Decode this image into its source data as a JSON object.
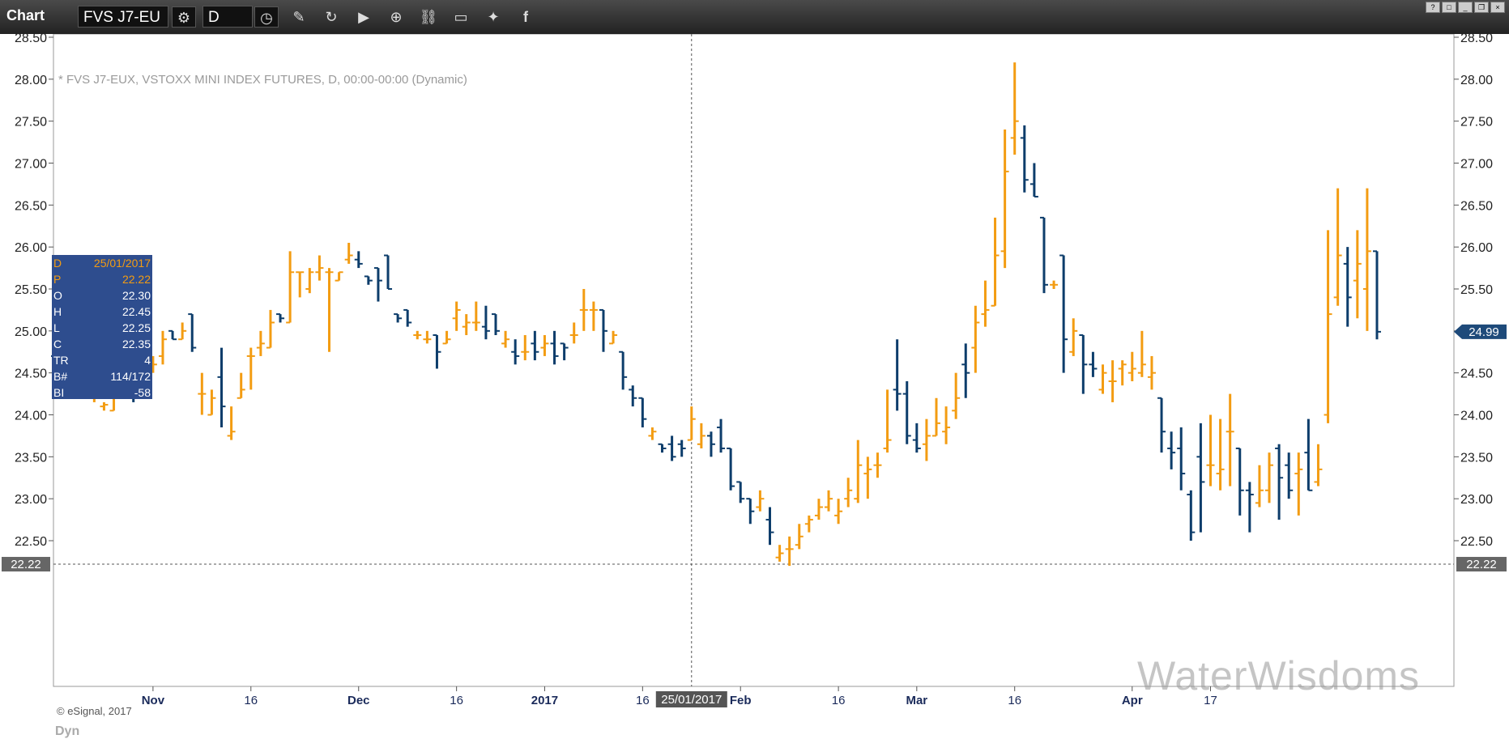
{
  "toolbar": {
    "title": "Chart",
    "symbol": "FVS J7-EU",
    "interval": "D"
  },
  "chart_title": "* FVS J7-EUX, VSTOXX MINI INDEX FUTURES, D, 00:00-00:00 (Dynamic)",
  "copyright": "© eSignal, 2017",
  "watermark": "WaterWisdoms",
  "dyn_label": "Dyn",
  "data_window": {
    "rows": [
      {
        "k": "D",
        "v": "25/01/2017",
        "hl": true
      },
      {
        "k": "P",
        "v": "22.22",
        "hl": true
      },
      {
        "k": "O",
        "v": "22.30",
        "hl": false
      },
      {
        "k": "H",
        "v": "22.45",
        "hl": false
      },
      {
        "k": "L",
        "v": "22.25",
        "hl": false
      },
      {
        "k": "C",
        "v": "22.35",
        "hl": false
      },
      {
        "k": "TR",
        "v": "4",
        "hl": false
      },
      {
        "k": "B#",
        "v": "114/172",
        "hl": false
      },
      {
        "k": "BI",
        "v": "-58",
        "hl": false
      }
    ]
  },
  "colors": {
    "up": "#f39c12",
    "down": "#0d3d6b",
    "badge": "#1e4a7a"
  },
  "chart_data": {
    "type": "ohlc",
    "ylim": [
      22.0,
      28.6
    ],
    "y_ticks": [
      "28.50",
      "28.00",
      "27.50",
      "27.00",
      "26.50",
      "26.00",
      "25.50",
      "25.00",
      "24.50",
      "24.00",
      "23.50",
      "23.00",
      "22.50"
    ],
    "x_tick_labels": [
      {
        "label": "Nov",
        "idx": 10,
        "bold": true
      },
      {
        "label": "16",
        "idx": 20,
        "bold": false
      },
      {
        "label": "Dec",
        "idx": 31,
        "bold": true
      },
      {
        "label": "16",
        "idx": 41,
        "bold": false
      },
      {
        "label": "2017",
        "idx": 50,
        "bold": true
      },
      {
        "label": "16",
        "idx": 60,
        "bold": false
      },
      {
        "label": "Feb",
        "idx": 70,
        "bold": true
      },
      {
        "label": "16",
        "idx": 80,
        "bold": false
      },
      {
        "label": "Mar",
        "idx": 88,
        "bold": true
      },
      {
        "label": "16",
        "idx": 98,
        "bold": false
      },
      {
        "label": "Apr",
        "idx": 110,
        "bold": true
      },
      {
        "label": "17",
        "idx": 118,
        "bold": false
      }
    ],
    "crosshair": {
      "idx": 65,
      "date_label": "25/01/2017",
      "price": 22.22,
      "price_label": "22.22"
    },
    "last_price": {
      "value": 24.99,
      "label": "24.99"
    },
    "bars": [
      [
        24.7,
        24.75,
        24.6,
        24.6
      ],
      [
        24.45,
        24.5,
        24.45,
        24.48
      ],
      [
        24.45,
        24.45,
        24.35,
        24.4
      ],
      [
        24.3,
        24.35,
        24.25,
        24.32
      ],
      [
        24.2,
        24.3,
        24.15,
        24.25
      ],
      [
        24.1,
        24.15,
        24.05,
        24.12
      ],
      [
        24.05,
        24.35,
        24.05,
        24.3
      ],
      [
        24.3,
        24.5,
        24.25,
        24.3
      ],
      [
        24.3,
        24.3,
        24.15,
        24.25
      ],
      [
        24.5,
        24.6,
        24.5,
        24.55
      ],
      [
        24.55,
        24.7,
        24.5,
        24.6
      ],
      [
        24.7,
        25.0,
        24.6,
        24.9
      ],
      [
        25.0,
        25.0,
        24.9,
        24.9
      ],
      [
        24.9,
        25.1,
        24.9,
        25.0
      ],
      [
        25.2,
        25.2,
        24.75,
        24.8
      ],
      [
        24.25,
        24.5,
        24.0,
        24.25
      ],
      [
        24.0,
        24.3,
        24.0,
        24.2
      ],
      [
        24.45,
        24.8,
        23.85,
        24.1
      ],
      [
        23.75,
        24.1,
        23.7,
        23.8
      ],
      [
        24.2,
        24.5,
        24.2,
        24.3
      ],
      [
        24.7,
        24.8,
        24.3,
        24.7
      ],
      [
        24.8,
        25.0,
        24.7,
        24.85
      ],
      [
        24.8,
        25.25,
        24.8,
        25.1
      ],
      [
        25.2,
        25.2,
        25.1,
        25.15
      ],
      [
        25.1,
        25.95,
        25.1,
        25.7
      ],
      [
        25.7,
        25.7,
        25.4,
        25.7
      ],
      [
        25.5,
        25.75,
        25.45,
        25.7
      ],
      [
        25.7,
        25.9,
        25.6,
        25.75
      ],
      [
        25.7,
        25.75,
        24.75,
        25.7
      ],
      [
        25.6,
        25.7,
        25.6,
        25.7
      ],
      [
        25.85,
        26.05,
        25.8,
        25.9
      ],
      [
        25.85,
        25.95,
        25.75,
        25.8
      ],
      [
        25.65,
        25.65,
        25.55,
        25.6
      ],
      [
        25.75,
        25.75,
        25.35,
        25.6
      ],
      [
        25.9,
        25.9,
        25.5,
        25.5
      ],
      [
        25.2,
        25.2,
        25.1,
        25.15
      ],
      [
        25.25,
        25.25,
        25.05,
        25.1
      ],
      [
        24.95,
        25.0,
        24.9,
        24.95
      ],
      [
        24.9,
        25.0,
        24.85,
        24.9
      ],
      [
        24.95,
        24.95,
        24.55,
        24.75
      ],
      [
        24.85,
        25.0,
        24.85,
        24.9
      ],
      [
        25.15,
        25.35,
        25.0,
        25.25
      ],
      [
        25.05,
        25.2,
        24.95,
        25.1
      ],
      [
        25.1,
        25.35,
        25.0,
        25.1
      ],
      [
        25.05,
        25.3,
        24.9,
        25.0
      ],
      [
        25.2,
        25.2,
        24.95,
        25.0
      ],
      [
        24.85,
        25.0,
        24.8,
        24.9
      ],
      [
        24.75,
        24.9,
        24.6,
        24.7
      ],
      [
        24.75,
        24.95,
        24.65,
        24.75
      ],
      [
        24.85,
        25.0,
        24.65,
        24.75
      ],
      [
        24.8,
        24.95,
        24.7,
        24.85
      ],
      [
        24.85,
        25.0,
        24.6,
        24.7
      ],
      [
        24.85,
        24.85,
        24.65,
        24.8
      ],
      [
        24.95,
        25.1,
        24.85,
        24.95
      ],
      [
        25.25,
        25.5,
        25.0,
        25.25
      ],
      [
        25.25,
        25.35,
        25.0,
        25.25
      ],
      [
        25.25,
        25.25,
        24.75,
        25.0
      ],
      [
        24.85,
        25.0,
        24.85,
        24.95
      ],
      [
        24.75,
        24.75,
        24.3,
        24.45
      ],
      [
        24.3,
        24.35,
        24.1,
        24.2
      ],
      [
        24.2,
        24.2,
        23.85,
        23.95
      ],
      [
        23.75,
        23.85,
        23.7,
        23.8
      ],
      [
        23.65,
        23.65,
        23.55,
        23.6
      ],
      [
        23.65,
        23.75,
        23.45,
        23.5
      ]
    ],
    "bars_b": [
      [
        23.65,
        23.7,
        23.5,
        23.6
      ],
      [
        23.7,
        24.1,
        23.7,
        23.95
      ],
      [
        23.65,
        23.9,
        23.6,
        23.75
      ],
      [
        23.75,
        23.8,
        23.5,
        23.65
      ],
      [
        23.85,
        23.95,
        23.55,
        23.6
      ],
      [
        23.6,
        23.6,
        23.1,
        23.15
      ],
      [
        23.2,
        23.2,
        22.95,
        23.0
      ],
      [
        23.0,
        23.0,
        22.7,
        22.85
      ],
      [
        22.9,
        23.1,
        22.85,
        23.0
      ],
      [
        22.75,
        22.9,
        22.45,
        22.6
      ],
      [
        22.3,
        22.45,
        22.25,
        22.35
      ],
      [
        22.4,
        22.55,
        22.2,
        22.4
      ],
      [
        22.45,
        22.7,
        22.4,
        22.55
      ],
      [
        22.7,
        22.8,
        22.6,
        22.75
      ],
      [
        22.8,
        23.0,
        22.75,
        22.9
      ],
      [
        22.9,
        23.1,
        22.85,
        23.0
      ],
      [
        22.8,
        23.0,
        22.7,
        22.85
      ],
      [
        23.0,
        23.25,
        22.9,
        23.1
      ],
      [
        23.0,
        23.7,
        22.95,
        23.4
      ],
      [
        23.3,
        23.5,
        23.0,
        23.35
      ],
      [
        23.4,
        23.55,
        23.25,
        23.4
      ],
      [
        23.6,
        24.3,
        23.55,
        23.7
      ],
      [
        24.3,
        24.9,
        24.05,
        24.25
      ],
      [
        24.25,
        24.4,
        23.65,
        23.75
      ],
      [
        23.7,
        23.9,
        23.55,
        23.6
      ],
      [
        23.65,
        23.95,
        23.45,
        23.75
      ],
      [
        23.75,
        24.2,
        23.75,
        23.9
      ],
      [
        23.8,
        24.1,
        23.65,
        23.85
      ],
      [
        24.05,
        24.5,
        23.95,
        24.2
      ],
      [
        24.6,
        24.85,
        24.2,
        24.5
      ],
      [
        24.8,
        25.3,
        24.5,
        25.1
      ],
      [
        25.2,
        25.6,
        25.05,
        25.25
      ],
      [
        25.3,
        26.35,
        25.3,
        25.9
      ],
      [
        25.95,
        27.4,
        25.75,
        26.9
      ],
      [
        27.3,
        28.2,
        27.1,
        27.5
      ],
      [
        27.3,
        27.45,
        26.65,
        26.8
      ],
      [
        26.75,
        27.0,
        26.6,
        26.6
      ],
      [
        26.35,
        26.35,
        25.45,
        25.55
      ],
      [
        25.55,
        25.6,
        25.5,
        25.55
      ],
      [
        25.9,
        25.9,
        24.5,
        24.9
      ],
      [
        24.75,
        25.15,
        24.7,
        25.0
      ],
      [
        24.95,
        24.95,
        24.25,
        24.6
      ],
      [
        24.6,
        24.75,
        24.45,
        24.55
      ],
      [
        24.3,
        24.6,
        24.25,
        24.5
      ],
      [
        24.4,
        24.65,
        24.15,
        24.4
      ],
      [
        24.55,
        24.65,
        24.35,
        24.6
      ],
      [
        24.5,
        24.75,
        24.4,
        24.55
      ],
      [
        24.5,
        25.0,
        24.45,
        24.6
      ],
      [
        24.45,
        24.7,
        24.3,
        24.5
      ],
      [
        24.2,
        24.2,
        23.55,
        23.8
      ],
      [
        23.6,
        23.8,
        23.35,
        23.55
      ],
      [
        23.6,
        23.85,
        23.1,
        23.3
      ],
      [
        23.05,
        23.1,
        22.5,
        22.6
      ],
      [
        23.5,
        23.9,
        22.6,
        23.2
      ],
      [
        23.4,
        24.0,
        23.15,
        23.4
      ],
      [
        23.3,
        23.95,
        23.1,
        23.35
      ],
      [
        23.8,
        24.25,
        23.15,
        23.8
      ],
      [
        23.6,
        23.6,
        22.8,
        23.1
      ],
      [
        23.1,
        23.2,
        22.6,
        23.05
      ],
      [
        22.95,
        23.4,
        22.9,
        23.1
      ],
      [
        23.1,
        23.55,
        22.95,
        23.4
      ],
      [
        23.6,
        23.65,
        22.75,
        23.25
      ],
      [
        23.4,
        23.55,
        23.0,
        23.1
      ],
      [
        23.3,
        23.55,
        22.8,
        23.35
      ],
      [
        23.55,
        23.95,
        23.1,
        23.1
      ],
      [
        23.2,
        23.65,
        23.15,
        23.35
      ],
      [
        24.0,
        26.2,
        23.9,
        25.2
      ],
      [
        25.4,
        26.7,
        25.3,
        25.9
      ],
      [
        25.8,
        26.0,
        25.05,
        25.4
      ],
      [
        25.6,
        26.2,
        25.15,
        25.8
      ],
      [
        25.5,
        26.7,
        25.0,
        25.95
      ],
      [
        25.95,
        25.95,
        24.9,
        24.99
      ]
    ]
  }
}
